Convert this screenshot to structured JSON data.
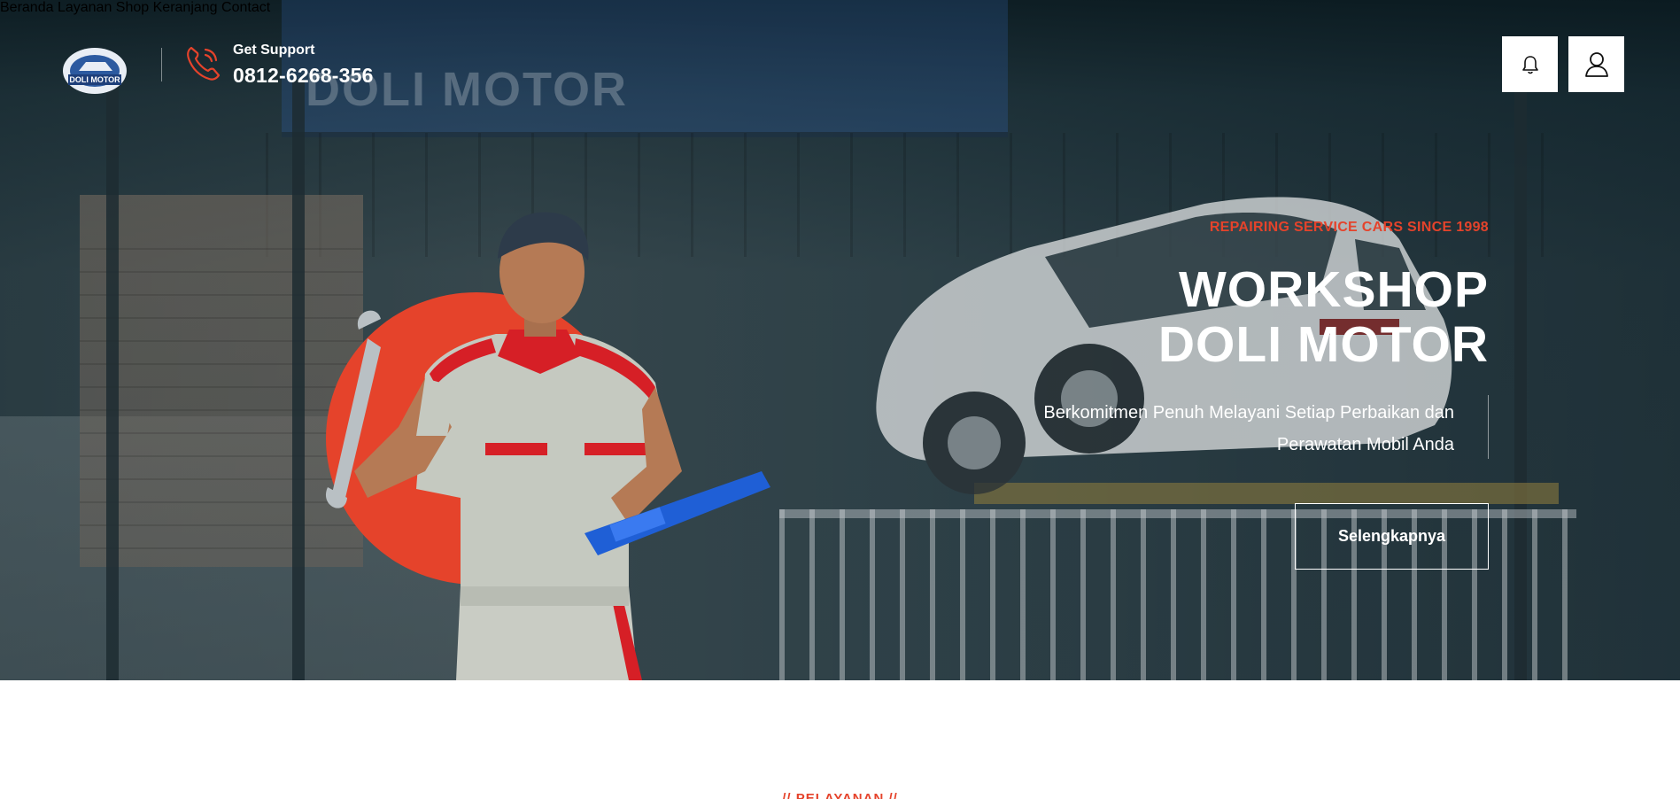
{
  "brand": {
    "logo_text": "DOLI MOTOR",
    "accent_color": "#e5432b"
  },
  "header": {
    "support_label": "Get Support",
    "support_phone": "0812-6268-356",
    "nav": [
      {
        "label": "Beranda"
      },
      {
        "label": "Layanan"
      },
      {
        "label": "Shop"
      },
      {
        "label": "Keranjang"
      },
      {
        "label": "Contact"
      }
    ],
    "icons": [
      "bell-icon",
      "user-icon"
    ]
  },
  "hero": {
    "tagline": "REPAIRING SERVICE CARS SINCE 1998",
    "title_line1": "WORKSHOP",
    "title_line2": "DOLI MOTOR",
    "description_line1": "Berkomitmen Penuh Melayani Setiap Perbaikan dan",
    "description_line2": "Perawatan Mobil Anda",
    "cta_label": "Selengkapnya",
    "background_sign_text": "DOLI MOTOR"
  },
  "services_section": {
    "eyebrow": "// PELAYANAN //"
  }
}
